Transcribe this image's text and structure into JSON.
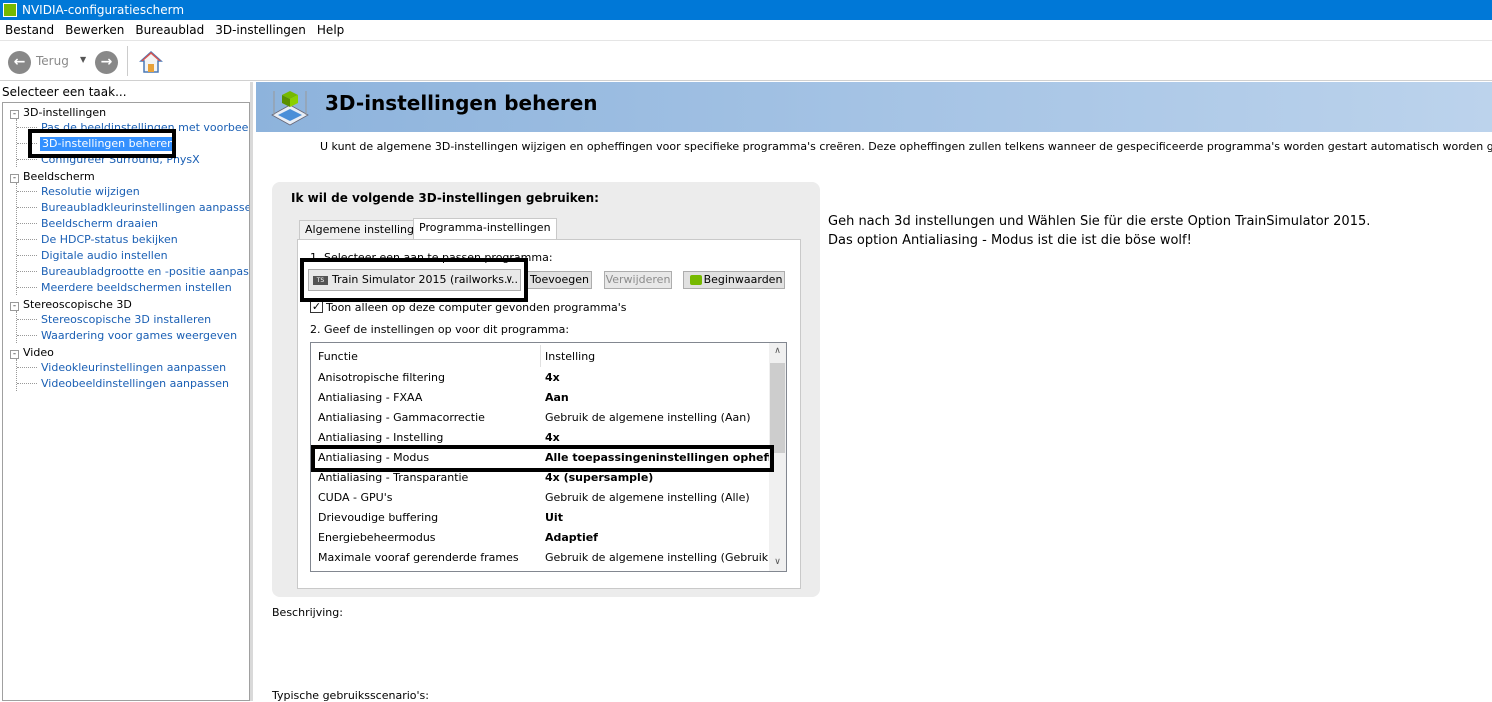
{
  "window": {
    "title": "NVIDIA-configuratiescherm"
  },
  "menu": [
    "Bestand",
    "Bewerken",
    "Bureaublad",
    "3D-instellingen",
    "Help"
  ],
  "toolbar": {
    "back_label": "Terug"
  },
  "sidebar": {
    "title": "Selecteer een taak...",
    "groups": [
      {
        "label": "3D-instellingen",
        "items": [
          "Pas de beeldinstellingen met voorbeeld aan",
          "3D-instellingen beheren",
          "Configureer Surround, PhysX"
        ]
      },
      {
        "label": "Beeldscherm",
        "items": [
          "Resolutie wijzigen",
          "Bureaubladkleurinstellingen aanpassen",
          "Beeldscherm draaien",
          "De HDCP-status bekijken",
          "Digitale audio instellen",
          "Bureaubladgrootte en -positie aanpassen",
          "Meerdere beeldschermen instellen"
        ]
      },
      {
        "label": "Stereoscopische 3D",
        "items": [
          "Stereoscopische 3D installeren",
          "Waardering voor games weergeven"
        ]
      },
      {
        "label": "Video",
        "items": [
          "Videokleurinstellingen aanpassen",
          "Videobeeldinstellingen aanpassen"
        ]
      }
    ]
  },
  "page": {
    "title": "3D-instellingen beheren",
    "description": "U kunt de algemene 3D-instellingen wijzigen en opheffingen voor specifieke programma's creëren. Deze opheffingen zullen telkens wanneer de gespecificeerde programma's worden gestart automatisch worden gebruikt.",
    "panel_title": "Ik wil de volgende 3D-instellingen gebruiken:",
    "tabs": [
      "Algemene instellingen",
      "Programma-instellingen"
    ],
    "step1": "1. Selecteer een aan te passen programma:",
    "program_selected": "Train Simulator 2015 (railworks....",
    "program_icon_text": "TS",
    "buttons": {
      "add": "Toevoegen",
      "remove": "Verwijderen",
      "defaults": "Beginwaarden"
    },
    "checkbox_label": "Toon alleen op deze computer gevonden programma's",
    "step2": "2. Geef de instellingen op voor dit programma:",
    "table": {
      "headers": [
        "Functie",
        "Instelling"
      ],
      "rows": [
        {
          "f": "Anisotropische filtering",
          "v": "4x",
          "bold": true
        },
        {
          "f": "Antialiasing - FXAA",
          "v": "Aan",
          "bold": true
        },
        {
          "f": "Antialiasing - Gammacorrectie",
          "v": "Gebruik de algemene instelling (Aan)",
          "bold": false
        },
        {
          "f": "Antialiasing - Instelling",
          "v": "4x",
          "bold": true
        },
        {
          "f": "Antialiasing - Modus",
          "v": "Alle toepassingeninstellingen opheff...",
          "bold": true
        },
        {
          "f": "Antialiasing - Transparantie",
          "v": "4x (supersample)",
          "bold": true
        },
        {
          "f": "CUDA - GPU's",
          "v": "Gebruik de algemene instelling (Alle)",
          "bold": false
        },
        {
          "f": "Drievoudige buffering",
          "v": "Uit",
          "bold": true
        },
        {
          "f": "Energiebeheermodus",
          "v": "Adaptief",
          "bold": true
        },
        {
          "f": "Maximale vooraf gerenderde frames",
          "v": "Gebruik de algemene instelling (Gebruik de...",
          "bold": false
        }
      ]
    },
    "description_label": "Beschrijving:",
    "usage_label": "Typische gebruiksscenario's:"
  },
  "annotation": {
    "line1": "Geh nach 3d instellungen und Wählen Sie für die erste Option TrainSimulator 2015.",
    "line2": "Das option Antialiasing - Modus ist die ist die böse wolf!"
  }
}
